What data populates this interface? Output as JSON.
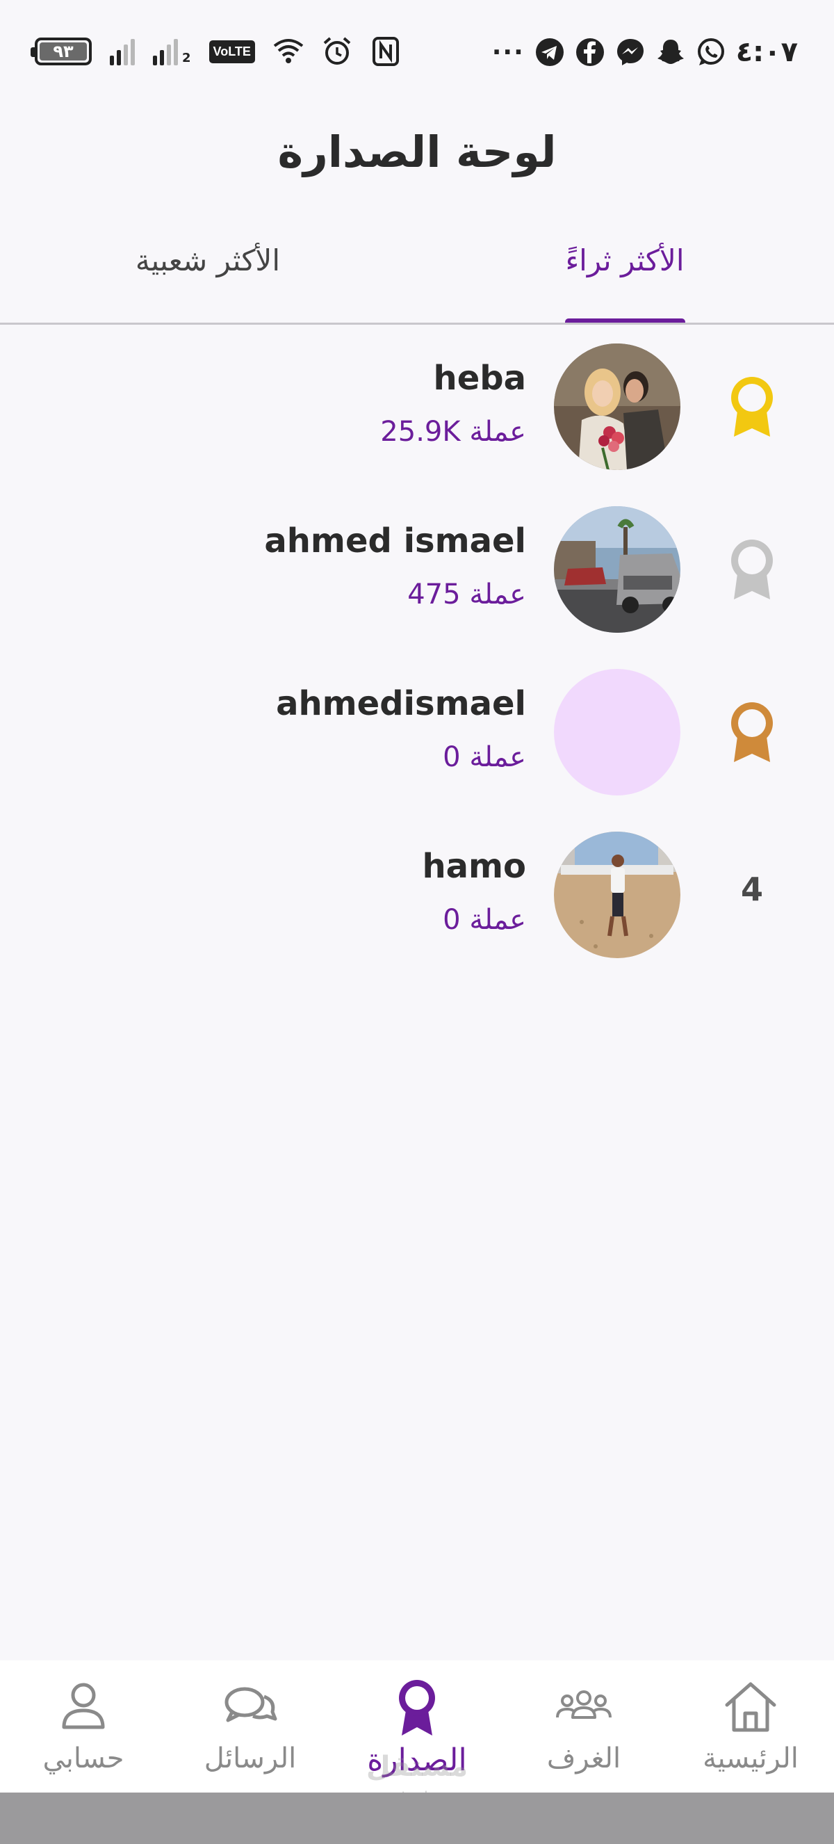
{
  "status_bar": {
    "time": "٤:٠٧",
    "battery": "٩٣",
    "sim_label": "2",
    "volte": "VoLTE",
    "more": "···",
    "icons_right": [
      "telegram-icon",
      "facebook-icon",
      "messenger-icon",
      "snapchat-icon",
      "whatsapp-icon"
    ],
    "icons_left": [
      "wifi-icon",
      "alarm-icon",
      "nfc-icon"
    ]
  },
  "header": {
    "title": "لوحة الصدارة"
  },
  "tabs": [
    {
      "label": "الأكثر ثراءً",
      "active": true
    },
    {
      "label": "الأكثر شعبية",
      "active": false
    }
  ],
  "leaderboard": [
    {
      "rank": 1,
      "name": "heba",
      "coins": "25.9K",
      "badge": "gold-medal-icon",
      "badge_color": "#f2c811"
    },
    {
      "rank": 2,
      "name": "ahmed ismael",
      "coins": "475",
      "badge": "silver-medal-icon",
      "badge_color": "#c4c4c4"
    },
    {
      "rank": 3,
      "name": "ahmedismael",
      "coins": "0",
      "badge": "bronze-medal-icon",
      "badge_color": "#cf8a3a"
    },
    {
      "rank": 4,
      "name": "hamo",
      "coins": "0",
      "badge_text": "4"
    }
  ],
  "currency_label": "عملة",
  "bottom_nav": [
    {
      "label": "حسابي",
      "icon": "user-icon"
    },
    {
      "label": "الرسائل",
      "icon": "chat-icon"
    },
    {
      "label": "الصدارة",
      "icon": "medal-icon",
      "active": true
    },
    {
      "label": "الغرف",
      "icon": "group-icon"
    },
    {
      "label": "الرئيسية",
      "icon": "home-icon"
    }
  ],
  "watermark": {
    "text": "مستقل",
    "sub": "mostaql.com"
  },
  "colors": {
    "accent": "#6b1d9b",
    "background": "#f8f7fa",
    "text": "#2b2b2b",
    "nav_inactive": "#8a8a8a",
    "avatar_placeholder": "#f1d9fd"
  }
}
